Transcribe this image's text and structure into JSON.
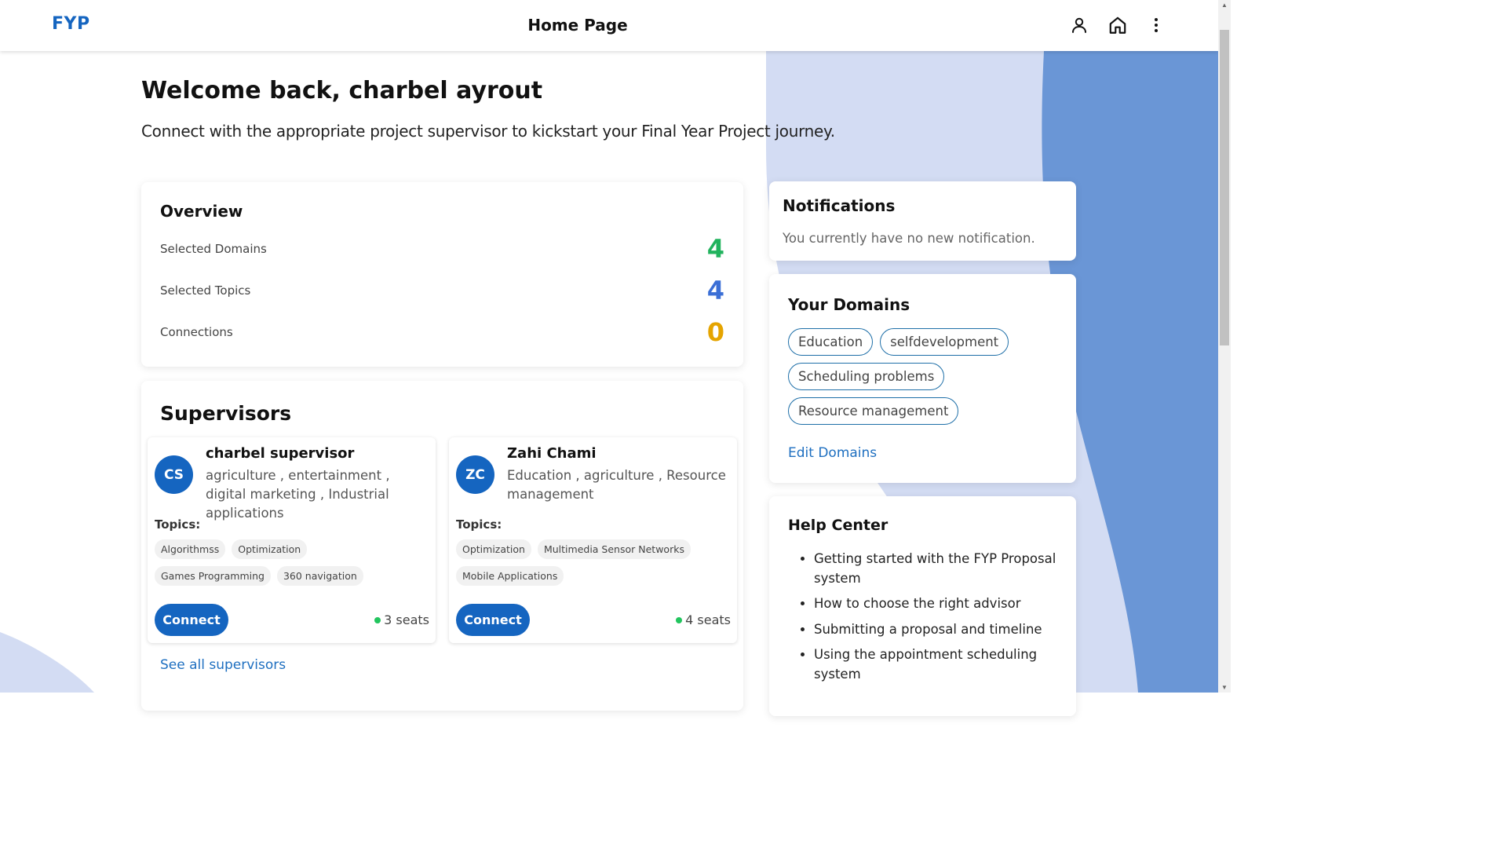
{
  "topbar": {
    "logo": "FYP",
    "title": "Home Page",
    "icons": [
      "person-icon",
      "home-icon",
      "more-vertical-icon"
    ]
  },
  "welcome": {
    "heading": "Welcome back, charbel ayrout",
    "subtitle": "Connect with the appropriate project supervisor to kickstart your Final Year Project journey."
  },
  "overview": {
    "title": "Overview",
    "rows": [
      {
        "label": "Selected Domains",
        "value": "4",
        "color": "#22b35e"
      },
      {
        "label": "Selected Topics",
        "value": "4",
        "color": "#3b6fd6"
      },
      {
        "label": "Connections",
        "value": "0",
        "color": "#e5a400"
      }
    ]
  },
  "supervisors": {
    "title": "Supervisors",
    "topics_label": "Topics:",
    "connect_label": "Connect",
    "see_all": "See all supervisors",
    "items": [
      {
        "initials": "CS",
        "name": "charbel supervisor",
        "domains": "agriculture , entertainment , digital marketing , Industrial applications",
        "topics": [
          "Algorithmss",
          "Optimization",
          "Games Programming",
          "360 navigation"
        ],
        "seats": "3 seats"
      },
      {
        "initials": "ZC",
        "name": "Zahi Chami",
        "domains": "Education , agriculture , Resource management",
        "topics": [
          "Optimization",
          "Multimedia Sensor Networks",
          "Mobile Applications"
        ],
        "seats": "4 seats"
      }
    ]
  },
  "notifications": {
    "title": "Notifications",
    "text": "You currently have no new notification."
  },
  "domains": {
    "title": "Your Domains",
    "items": [
      "Education",
      "selfdevelopment",
      "Scheduling problems",
      "Resource management"
    ],
    "edit_label": "Edit Domains"
  },
  "help": {
    "title": "Help Center",
    "items": [
      "Getting started with the FYP Proposal system",
      "How to choose the right advisor",
      "Submitting a proposal and timeline",
      "Using the appointment scheduling system"
    ]
  },
  "colors": {
    "brand": "#1565c0",
    "link": "#1e6fc0",
    "bg_light_blue": "#d3dcf3",
    "bg_mid_blue": "#6a96d6"
  }
}
